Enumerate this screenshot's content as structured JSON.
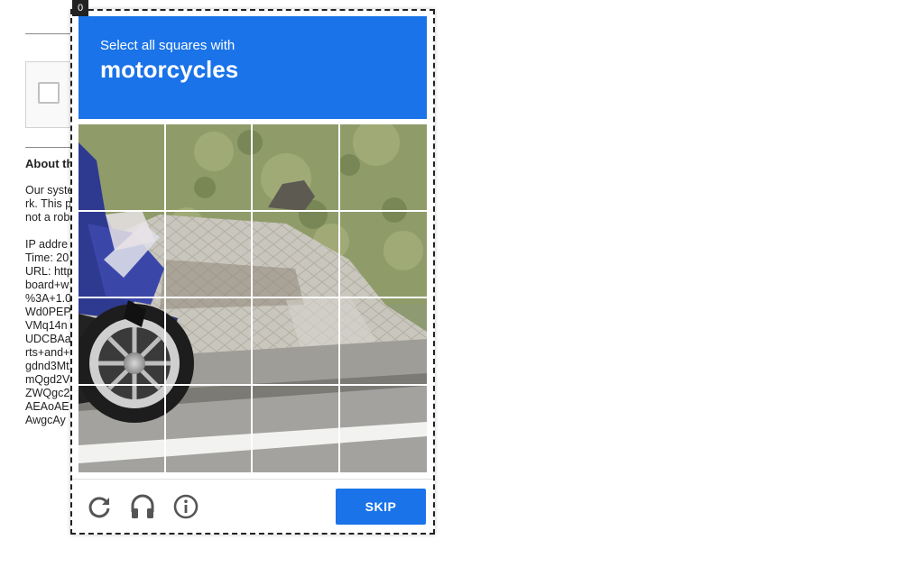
{
  "frame_index": "0",
  "background_page": {
    "about_heading": "About th",
    "lines": [
      "Our syste",
      "rk. This p",
      "not a rob",
      "",
      "IP addre",
      "Time: 20",
      "URL: http",
      "board+w",
      "%3A+1.0",
      "Wd0PEP",
      "VMq14n",
      "UDCBAa",
      "rts+and+",
      "gdnd3Mt",
      "mQgd2V",
      "ZWQgc2",
      "AEAoAE",
      "AwgcAy"
    ]
  },
  "challenge": {
    "instruction": "Select all squares with",
    "target_object": "motorcycles",
    "grid": {
      "rows": 4,
      "cols": 4
    },
    "footer": {
      "reload_icon": "reload-icon",
      "audio_icon": "headphones-icon",
      "info_icon": "info-icon",
      "skip_label": "SKIP"
    },
    "colors": {
      "accent": "#1a73e8",
      "icon_gray": "#555555"
    }
  }
}
